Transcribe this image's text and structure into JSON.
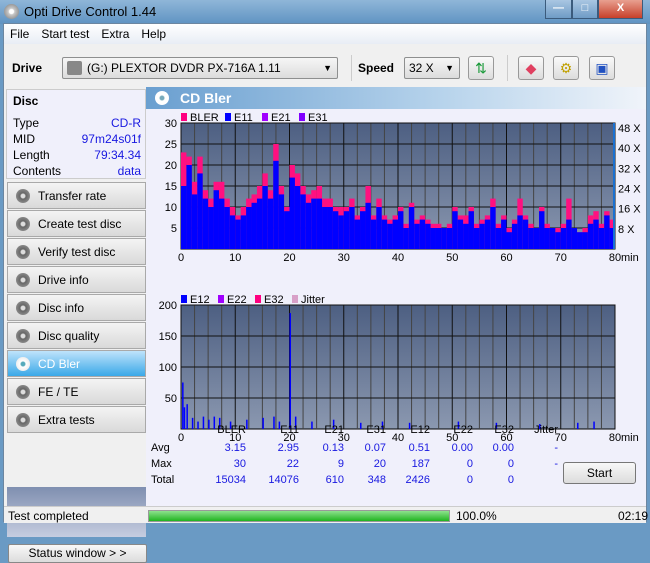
{
  "window": {
    "title": "Opti Drive Control 1.44",
    "minimize": "—",
    "maximize": "□",
    "close": "X"
  },
  "menu": [
    "File",
    "Start test",
    "Extra",
    "Help"
  ],
  "toolbar": {
    "drive_label": "Drive",
    "drive_value": "(G:)  PLEXTOR DVDR   PX-716A 1.11",
    "speed_label": "Speed",
    "speed_value": "32 X"
  },
  "disc": {
    "heading": "Disc",
    "rows": [
      {
        "k": "Type",
        "v": "CD-R"
      },
      {
        "k": "MID",
        "v": "97m24s01f"
      },
      {
        "k": "Length",
        "v": "79:34.34"
      },
      {
        "k": "Contents",
        "v": "data"
      }
    ]
  },
  "nav": [
    "Transfer rate",
    "Create test disc",
    "Verify test disc",
    "Drive info",
    "Disc info",
    "Disc quality",
    "CD Bler",
    "FE / TE",
    "Extra tests"
  ],
  "active_nav": "CD Bler",
  "status_window_btn": "Status window > >",
  "panel_title": "CD Bler",
  "chart_data": [
    {
      "type": "bar",
      "title": "BLER / E11 / E21 / E31",
      "legend": [
        "BLER",
        "E11",
        "E21",
        "E31"
      ],
      "legend_colors": [
        "#ff0080",
        "#0000ff",
        "#a000ff",
        "#8000ff"
      ],
      "xlabel": "min",
      "xlim": [
        0,
        80
      ],
      "ylim": [
        0,
        30
      ],
      "yticks": [
        5,
        10,
        15,
        20,
        25,
        30
      ],
      "xticks": [
        0,
        10,
        20,
        30,
        40,
        50,
        60,
        70,
        80
      ],
      "y2ticks": [
        "8 X",
        "16 X",
        "24 X",
        "32 X",
        "40 X",
        "48 X"
      ],
      "bler": [
        23,
        22,
        16,
        22,
        14,
        12,
        16,
        16,
        12,
        10,
        8,
        10,
        12,
        13,
        15,
        18,
        14,
        25,
        15,
        10,
        20,
        18,
        15,
        13,
        14,
        15,
        12,
        12,
        10,
        10,
        10,
        12,
        8,
        10,
        15,
        8,
        12,
        8,
        7,
        8,
        10,
        6,
        11,
        7,
        8,
        7,
        6,
        6,
        5,
        6,
        10,
        8,
        8,
        10,
        6,
        7,
        8,
        12,
        6,
        8,
        5,
        7,
        12,
        8,
        6,
        5,
        10,
        6,
        5,
        5,
        6,
        12,
        5,
        4,
        5,
        8,
        9,
        6,
        9,
        7
      ],
      "e11": [
        15,
        20,
        13,
        18,
        12,
        10,
        14,
        12,
        10,
        8,
        7,
        8,
        10,
        11,
        12,
        15,
        12,
        21,
        13,
        9,
        17,
        15,
        13,
        11,
        12,
        12,
        10,
        10,
        9,
        8,
        9,
        10,
        7,
        9,
        11,
        7,
        10,
        7,
        6,
        7,
        9,
        5,
        10,
        6,
        7,
        6,
        5,
        5,
        5,
        5,
        9,
        7,
        6,
        9,
        5,
        6,
        7,
        10,
        5,
        7,
        4,
        6,
        8,
        7,
        5,
        5,
        9,
        5,
        5,
        4,
        5,
        7,
        5,
        4,
        4,
        6,
        7,
        5,
        8,
        5
      ]
    },
    {
      "type": "bar",
      "legend": [
        "E12",
        "E22",
        "E32",
        "Jitter"
      ],
      "legend_colors": [
        "#0000ff",
        "#a000ff",
        "#ff0080",
        "#d8a0c8"
      ],
      "xlabel": "min",
      "xlim": [
        0,
        80
      ],
      "ylim": [
        0,
        200
      ],
      "yticks": [
        50,
        100,
        150,
        200
      ],
      "xticks": [
        0,
        10,
        20,
        30,
        40,
        50,
        60,
        70,
        80
      ],
      "e12_spikes": [
        [
          0.2,
          75
        ],
        [
          0.5,
          35
        ],
        [
          1,
          40
        ],
        [
          2,
          18
        ],
        [
          3,
          12
        ],
        [
          4,
          20
        ],
        [
          5,
          15
        ],
        [
          6,
          20
        ],
        [
          7,
          18
        ],
        [
          9,
          12
        ],
        [
          12,
          15
        ],
        [
          15,
          18
        ],
        [
          17,
          20
        ],
        [
          18,
          12
        ],
        [
          20,
          187
        ],
        [
          21,
          20
        ],
        [
          24,
          12
        ],
        [
          28,
          15
        ],
        [
          33,
          10
        ],
        [
          37,
          12
        ],
        [
          42,
          10
        ],
        [
          51,
          12
        ],
        [
          58,
          10
        ],
        [
          66,
          8
        ],
        [
          73,
          10
        ],
        [
          76,
          12
        ]
      ]
    }
  ],
  "stats": {
    "columns": [
      "BLER",
      "E11",
      "E21",
      "E31",
      "E12",
      "E22",
      "E32",
      "Jitter"
    ],
    "rows": [
      {
        "label": "Avg",
        "values": [
          "3.15",
          "2.95",
          "0.13",
          "0.07",
          "0.51",
          "0.00",
          "0.00",
          "-"
        ]
      },
      {
        "label": "Max",
        "values": [
          "30",
          "22",
          "9",
          "20",
          "187",
          "0",
          "0",
          "-"
        ]
      },
      {
        "label": "Total",
        "values": [
          "15034",
          "14076",
          "610",
          "348",
          "2426",
          "0",
          "0",
          ""
        ]
      }
    ]
  },
  "start_btn": "Start",
  "status": {
    "text": "Test completed",
    "progress_pct": 100,
    "progress_label": "100.0%",
    "time": "02:19"
  }
}
